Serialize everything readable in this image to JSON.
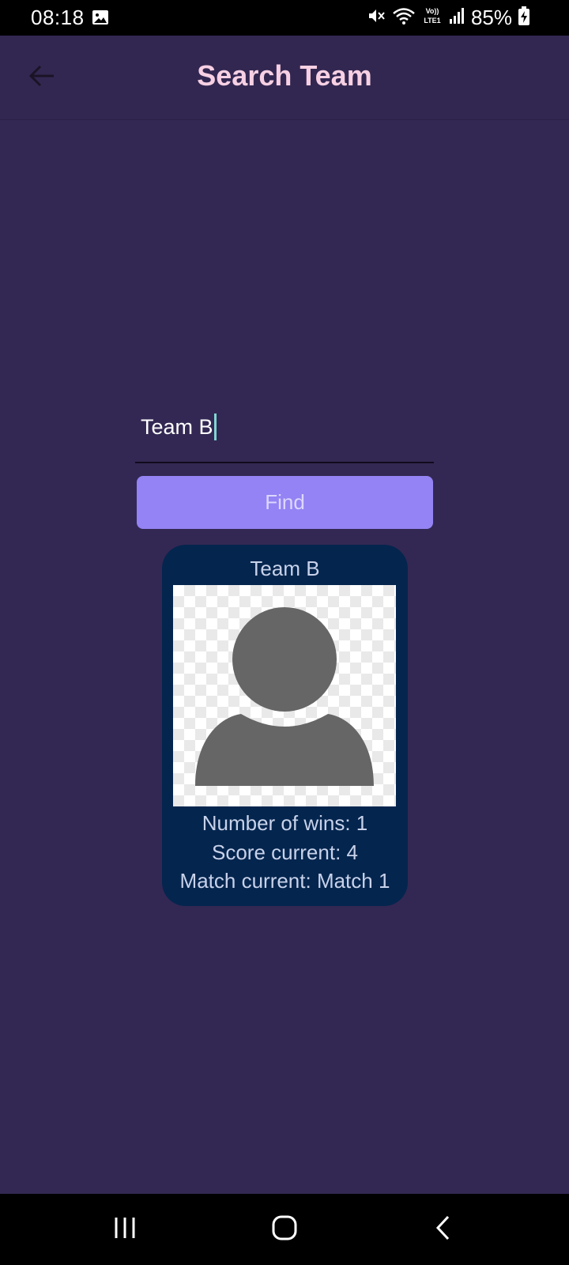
{
  "status_bar": {
    "time": "08:18",
    "battery_text": "85%",
    "icons": [
      "gallery-icon",
      "mute-icon",
      "wifi-icon",
      "volte-lte-icon",
      "signal-icon",
      "battery-charging-icon"
    ]
  },
  "app_bar": {
    "title": "Search Team",
    "back_icon": "arrow-left-icon"
  },
  "search": {
    "value": "Team B",
    "button_label": "Find"
  },
  "team_card": {
    "name": "Team B",
    "image_icon": "person-placeholder-icon",
    "wins": "Number of wins: 1",
    "score": "Score current: 4",
    "match": "Match current: Match 1"
  },
  "nav_bar": {
    "icons": [
      "recents-icon",
      "home-icon",
      "back-icon"
    ]
  },
  "colors": {
    "background": "#332853",
    "title": "#f7d0e3",
    "button": "#9383f4",
    "card": "#04254e",
    "card_text": "#c8d2ea"
  }
}
